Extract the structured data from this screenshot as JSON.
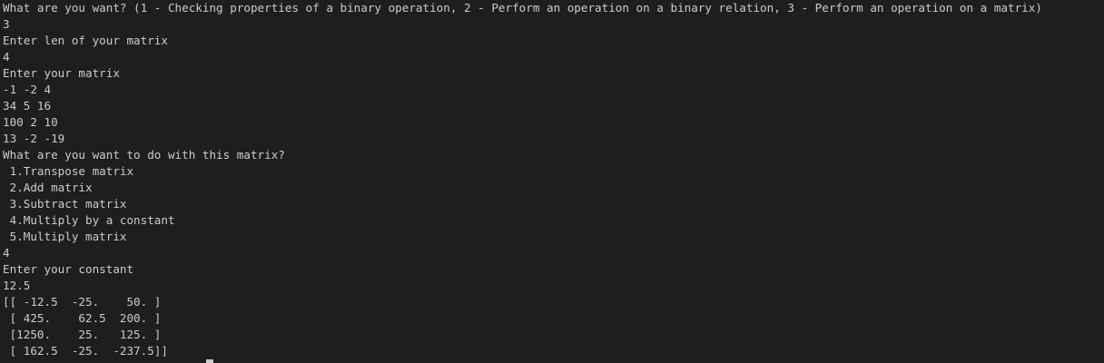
{
  "terminal": {
    "lines": [
      "What are you want? (1 - Checking properties of a binary operation, 2 - Perform an operation on a binary relation, 3 - Perform an operation on a matrix)",
      "3",
      "Enter len of your matrix",
      "4",
      "Enter your matrix",
      "-1 -2 4",
      "34 5 16",
      "100 2 10",
      "13 -2 -19",
      "What are you want to do with this matrix?",
      " 1.Transpose matrix",
      " 2.Add matrix",
      " 3.Subtract matrix",
      " 4.Multiply by a constant",
      " 5.Multiply matrix",
      "4",
      "Enter your constant",
      "12.5",
      "[[ -12.5  -25.    50. ]",
      " [ 425.    62.5  200. ]",
      " [1250.    25.   125. ]",
      " [ 162.5  -25.  -237.5]]"
    ]
  }
}
